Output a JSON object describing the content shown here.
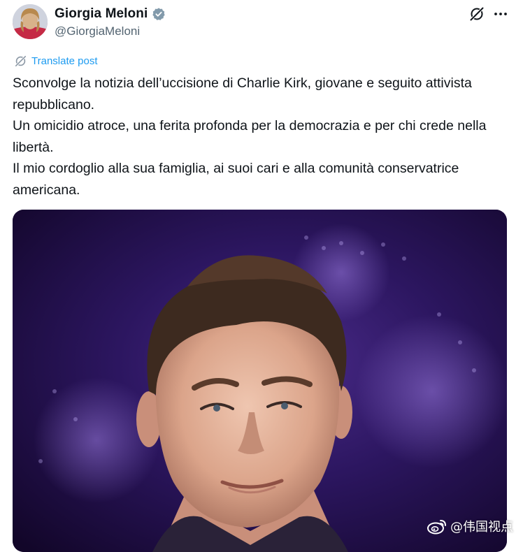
{
  "author": {
    "display_name": "Giorgia Meloni",
    "handle": "@GiorgiaMeloni",
    "verified": true
  },
  "actions": {
    "grok_icon": "grok-icon",
    "more_icon": "more-icon"
  },
  "translate": {
    "label": "Translate post",
    "icon": "translate-icon"
  },
  "post": {
    "paragraphs": [
      "Sconvolge la notizia dell’uccisione di Charlie Kirk, giovane e seguito attivista repubblicano.",
      "Un omicidio atroce, una ferita profonda per la democrazia e per chi crede nella libertà.",
      "Il mio cordoglio alla sua famiglia, ai suoi cari e alla comunità conservatrice americana."
    ]
  },
  "watermark": {
    "text": "@伟国视点",
    "icon": "weibo-icon"
  },
  "colors": {
    "accent": "#1d9bf0",
    "text": "#0f1419",
    "secondary": "#536471",
    "media_background": "#1b0a3a"
  }
}
